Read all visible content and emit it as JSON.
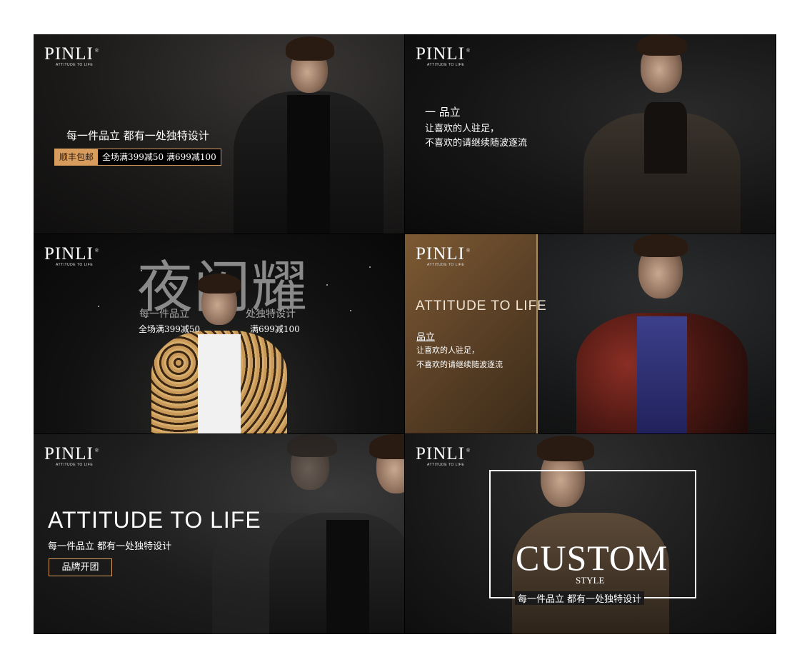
{
  "brand": {
    "name": "PINLI",
    "reg": "®",
    "tagline": "ATTITUDE TO LIFE"
  },
  "panel1": {
    "headline": "每一件品立   都有一处独特设计",
    "badge_left": "顺丰包邮",
    "badge_right": "全场满399减50  满699减100"
  },
  "panel2": {
    "line1": "一 品立",
    "line2": "让喜欢的人驻足，",
    "line3": "不喜欢的请继续随波逐流"
  },
  "panel3": {
    "big_title": "夜闪耀",
    "sub_left": "每一件品立",
    "sub_right": "处独特设计",
    "promo_left": "全场满399减50",
    "promo_right": "满699减100"
  },
  "panel4": {
    "title": "ATTITUDE TO LIFE",
    "line1": "品立",
    "line2": "让喜欢的人驻足，",
    "line3": "不喜欢的请继续随波逐流"
  },
  "panel5": {
    "title": "ATTITUDE TO LIFE",
    "subtitle": "每一件品立   都有一处独特设计",
    "button": "品牌开团"
  },
  "panel6": {
    "title": "CUSTOM",
    "style": "STYLE",
    "subtitle": "每一件品立   都有一处独特设计"
  },
  "colors": {
    "accent": "#d89c5c",
    "brown": "#6b4c2c"
  }
}
